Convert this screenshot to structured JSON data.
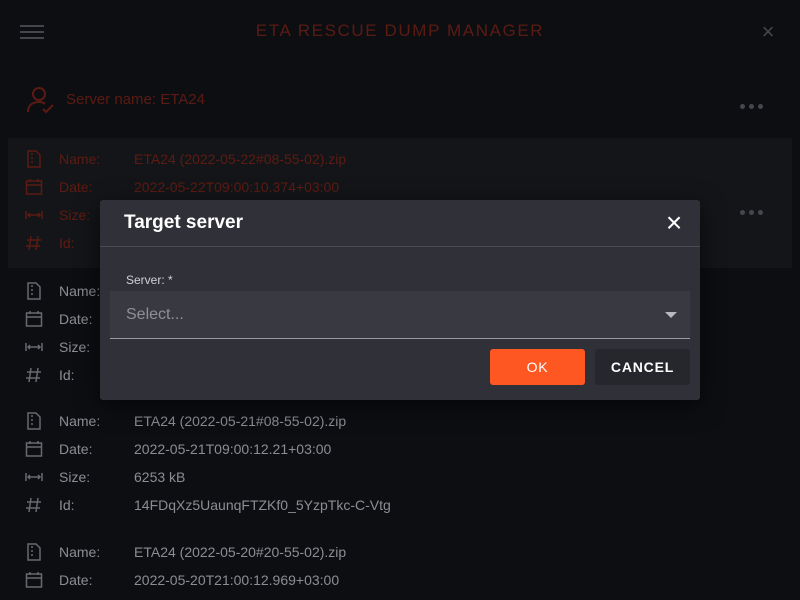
{
  "header": {
    "title": "ETA RESCUE DUMP MANAGER"
  },
  "server": {
    "label": "Server name: ETA24"
  },
  "labels": {
    "name": "Name:",
    "date": "Date:",
    "size": "Size:",
    "id": "Id:"
  },
  "dumps": [
    {
      "name": "ETA24 (2022-05-22#08-55-02).zip",
      "date": "2022-05-22T09:00:10.374+03:00"
    },
    {
      "name": "",
      "date": "",
      "size": "",
      "id": ""
    },
    {
      "name": "ETA24 (2022-05-21#08-55-02).zip",
      "date": "2022-05-21T09:00:12.21+03:00",
      "size": "6253 kB",
      "id": "14FDqXz5UaunqFTZKf0_5YzpTkc-C-Vtg"
    },
    {
      "name": "ETA24 (2022-05-20#20-55-02).zip",
      "date": "2022-05-20T21:00:12.969+03:00"
    }
  ],
  "dialog": {
    "title": "Target server",
    "field_label": "Server: *",
    "placeholder": "Select...",
    "ok_label": "OK",
    "cancel_label": "CANCEL"
  },
  "colors": {
    "accent": "#ff5722",
    "background": "#121318",
    "dialog": "#303038"
  }
}
